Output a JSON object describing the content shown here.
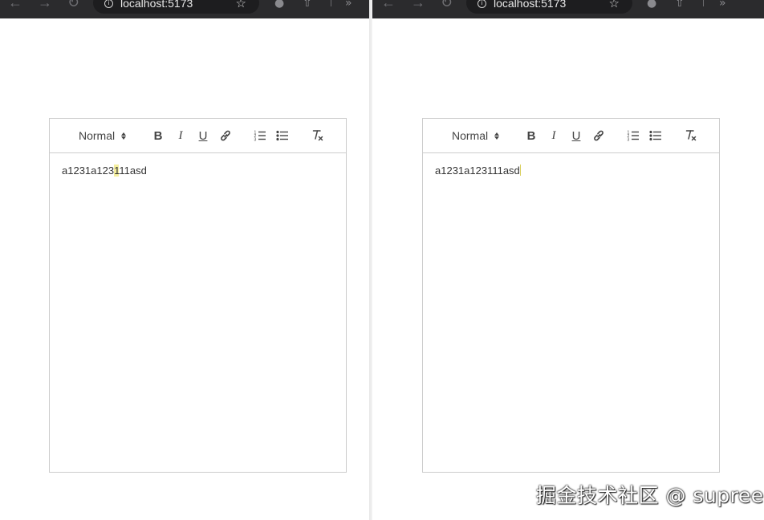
{
  "browser": {
    "url_left": "localhost:5173",
    "url_right": "localhost:5173"
  },
  "editor_left": {
    "header_picker": "Normal",
    "content_before_highlight": "a1231a123",
    "content_highlight": "1",
    "content_after_highlight": "11asd"
  },
  "editor_right": {
    "header_picker": "Normal",
    "content": "a1231a123111asd"
  },
  "toolbar": {
    "bold_label": "B",
    "italic_label": "I",
    "underline_label": "U"
  },
  "icons": [
    "back-icon",
    "forward-icon",
    "reload-icon",
    "info-icon",
    "star-icon",
    "extension-icon",
    "share-icon",
    "more-icon",
    "link-icon",
    "ordered-list-icon",
    "bullet-list-icon",
    "clear-format-icon"
  ],
  "colors": {
    "highlight": "#f5ef9f",
    "border": "#cccccc",
    "chrome": "#2b2b2d"
  },
  "watermark": "掘金技术社区 @ supree"
}
